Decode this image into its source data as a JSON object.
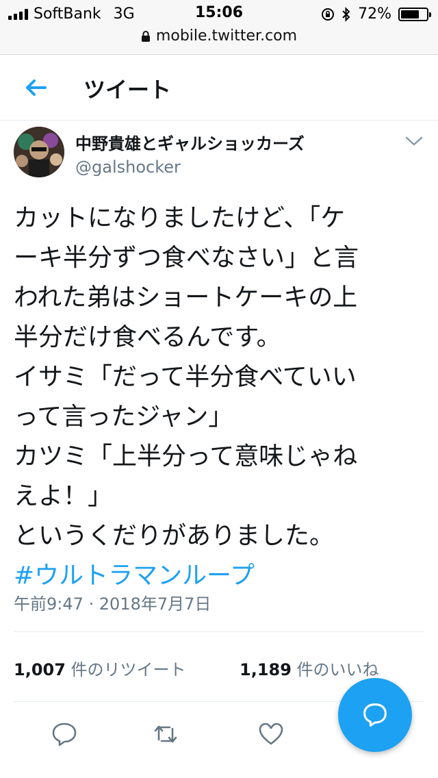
{
  "status_bar": {
    "carrier": "SoftBank",
    "network": "3G",
    "time": "15:06",
    "battery": "72%",
    "battery_level": 0.72,
    "url": "mobile.twitter.com"
  },
  "header": {
    "title": "ツイート"
  },
  "tweet": {
    "author_name": "中野貴雄とギャルショッカーズ",
    "author_handle": "@galshocker",
    "lines": [
      "カットになりましたけど、「ケ",
      "ーキ半分ずつ食べなさい」と言",
      "われた弟はショートケーキの上",
      "半分だけ食べるんです。",
      "イサミ「だって半分食べていい",
      "って言ったジャン」",
      "カツミ「上半分って意味じゃね",
      "えよ！」",
      "というくだりがありました。"
    ],
    "hashtag": "#ウルトラマンループ",
    "timestamp": "午前9:47 · 2018年7月7日",
    "retweet_count": "1,007",
    "retweet_label": " 件のリツイート",
    "like_count": "1,189",
    "like_label": " 件のいいね"
  },
  "icons": {
    "back": "arrow-left-icon",
    "caret": "chevron-down-icon",
    "reply": "reply-icon",
    "retweet": "retweet-icon",
    "like": "heart-icon",
    "compose": "compose-reply-icon",
    "lock": "lock-icon"
  },
  "colors": {
    "accent": "#1da1f2",
    "text": "#14171a",
    "secondary": "#657786"
  }
}
